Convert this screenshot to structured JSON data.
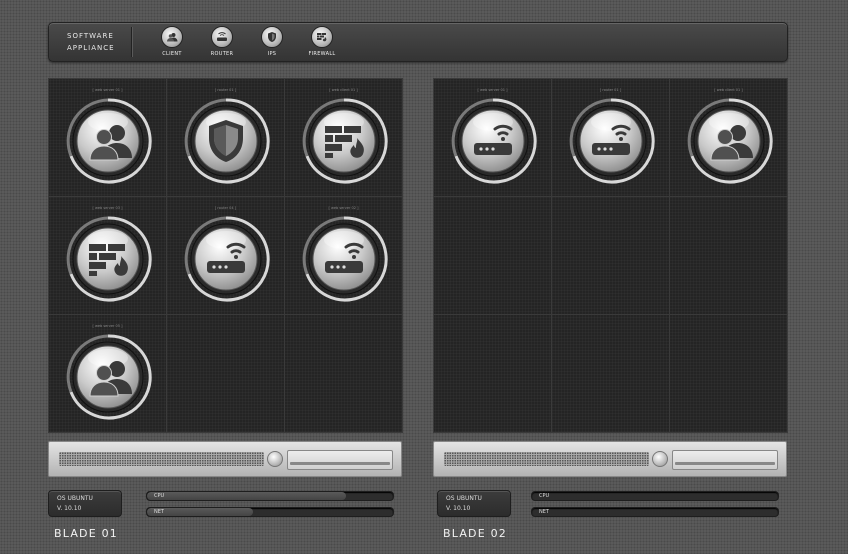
{
  "toolbar": {
    "brand_line1": "SOFTWARE",
    "brand_line2": "APPLIANCE",
    "tools": [
      {
        "label": "CLIENT",
        "icon": "client-icon"
      },
      {
        "label": "ROUTER",
        "icon": "router-icon"
      },
      {
        "label": "IPS",
        "icon": "shield-icon"
      },
      {
        "label": "FIREWALL",
        "icon": "firewall-icon"
      }
    ]
  },
  "blades": [
    {
      "title": "BLADE 01",
      "os_line1": "OS UBUNTU",
      "os_line2": "V. 10.10",
      "cpu_label": "CPU",
      "cpu_level": 0.81,
      "net_label": "NET",
      "net_level": 0.43,
      "nodes": [
        {
          "label": "[ web server 01 ]",
          "type": "client"
        },
        {
          "label": "[ router 01 ]",
          "type": "ips"
        },
        {
          "label": "[ web client 01 ]",
          "type": "firewall"
        },
        {
          "label": "[ web server 03 ]",
          "type": "firewall"
        },
        {
          "label": "[ router 04 ]",
          "type": "router"
        },
        {
          "label": "[ web server 02 ]",
          "type": "router"
        },
        {
          "label": "[ web server 05 ]",
          "type": "client"
        }
      ]
    },
    {
      "title": "BLADE 02",
      "os_line1": "OS UBUNTU",
      "os_line2": "V. 10.10",
      "cpu_label": "CPU",
      "cpu_level": 0.0,
      "net_label": "NET",
      "net_level": 0.0,
      "nodes": [
        {
          "label": "[ web server 01 ]",
          "type": "router"
        },
        {
          "label": "[ router 01 ]",
          "type": "router"
        },
        {
          "label": "[ web client 01 ]",
          "type": "client"
        }
      ]
    }
  ]
}
